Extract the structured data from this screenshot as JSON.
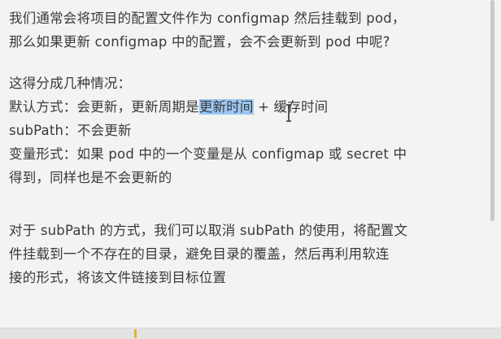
{
  "document": {
    "paragraph1": [
      "我们通常会将项目的配置文件作为 configmap 然后挂载到 pod，",
      "那么如果更新 configmap 中的配置，会不会更新到 pod 中呢?"
    ],
    "heading": "这得分成几种情况：",
    "default_case": {
      "prefix": "默认方式：会更新，更新周期是",
      "selected": "更新时间",
      "suffix": " + 缓存时间"
    },
    "subpath_case": "subPath：不会更新",
    "variable_case": [
      "变量形式：如果 pod 中的一个变量是从 configmap 或 secret 中",
      "得到，同样也是不会更新的"
    ],
    "paragraph3": [
      "对于 subPath 的方式，我们可以取消 subPath 的使用，将配置文",
      "件挂载到一个不存在的目录，避免目录的覆盖，然后再利用软连",
      "接的形式，将该文件链接到目标位置"
    ]
  },
  "colors": {
    "selection": "#9cc8f4",
    "background": "#f3f3f1",
    "accent": "#e0b43a"
  }
}
